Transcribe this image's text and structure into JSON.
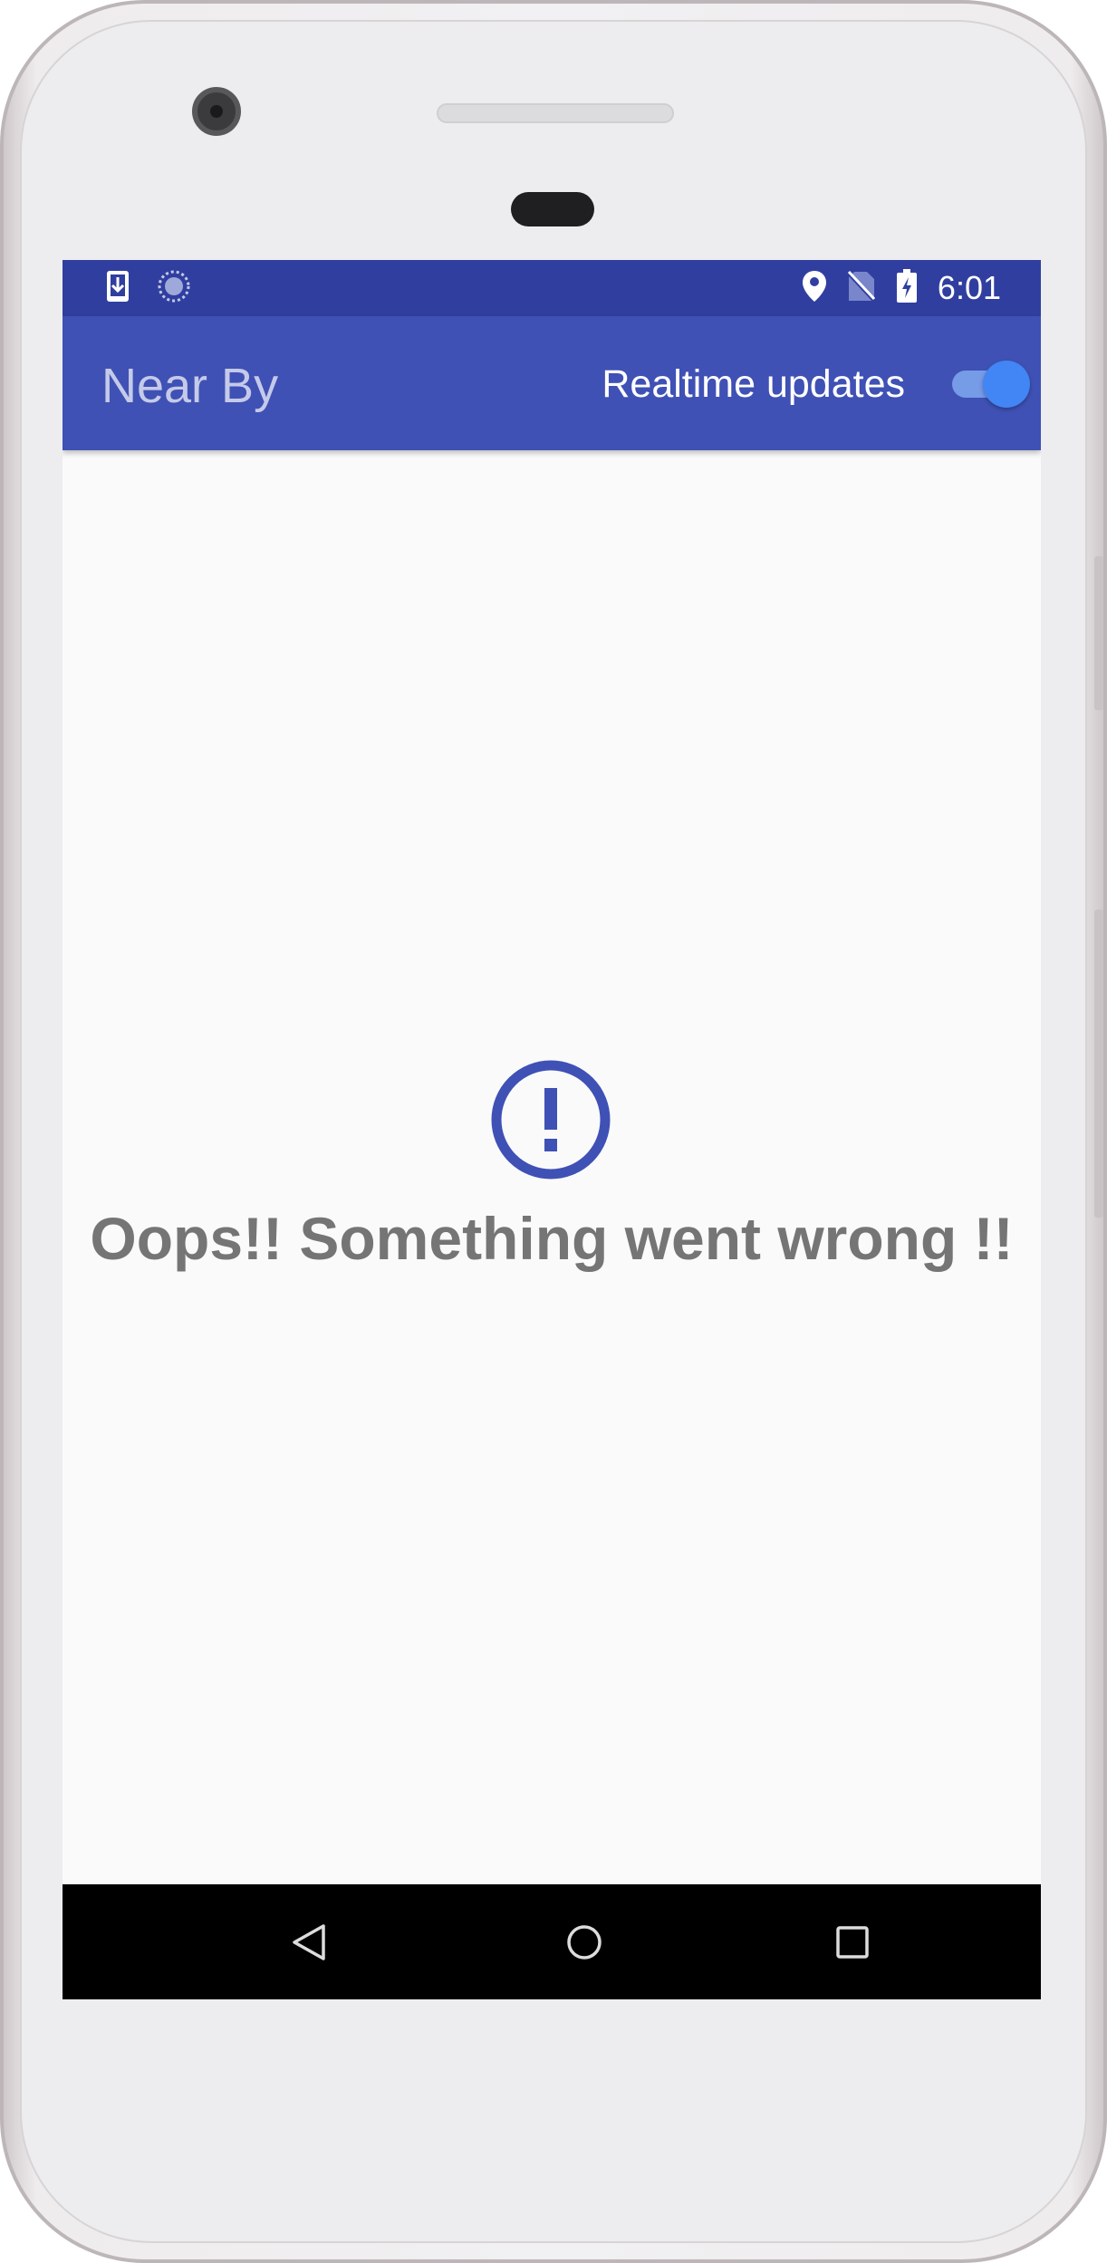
{
  "status_bar": {
    "time": "6:01",
    "left_icons": [
      "download-icon",
      "sync-icon"
    ],
    "right_icons": [
      "location-icon",
      "no-sim-icon",
      "battery-charging-icon"
    ]
  },
  "app_bar": {
    "title": "Near By",
    "toggle_label": "Realtime updates",
    "toggle_on": true
  },
  "content": {
    "error_icon": "alert-circle-icon",
    "error_message": "Oops!! Something went wrong !!"
  },
  "nav_bar": {
    "buttons": [
      "back-icon",
      "home-icon",
      "recents-icon"
    ]
  },
  "colors": {
    "status_bar": "#303f9f",
    "app_bar": "#3f51b5",
    "title_text": "#c5cae9",
    "switch_accent": "#4285f4",
    "error_icon": "#3f51b5",
    "error_text": "#757575",
    "background": "#fafafa"
  }
}
